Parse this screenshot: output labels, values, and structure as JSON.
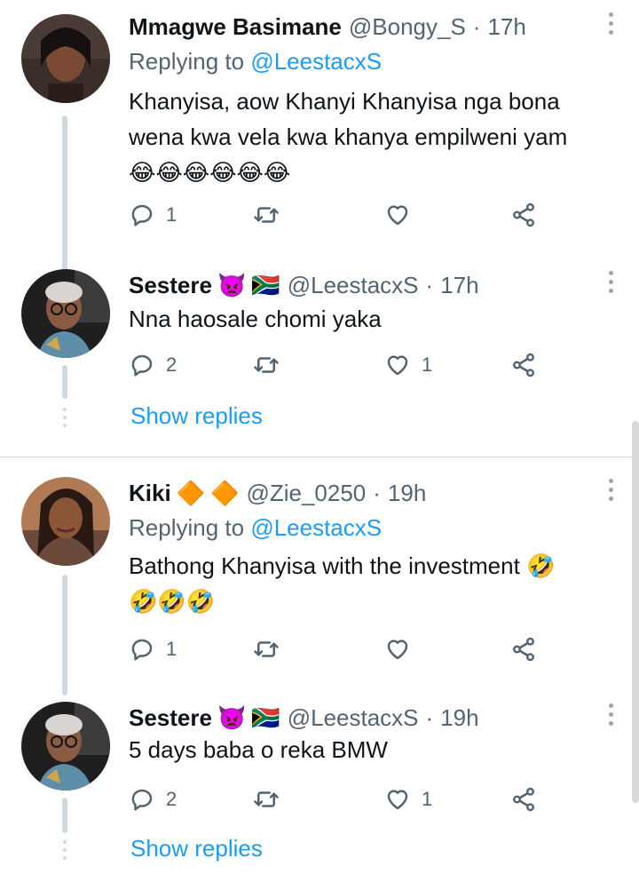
{
  "tweets": [
    {
      "name": "Mmagwe Basimane",
      "handle": "@Bongy_S",
      "separator": "·",
      "time": "17h",
      "replying_prefix": "Replying to ",
      "replying_to": "@LeestacxS",
      "text": "Khanyisa, aow Khanyi Khanyisa nga bona\nwena kwa vela kwa khanya empilweni yam\n😂😂😂😂😂😂",
      "reply_count": "1",
      "retweet_count": "",
      "like_count": ""
    },
    {
      "name": "Sestere",
      "badges": [
        "👿",
        "🇿🇦"
      ],
      "handle": "@LeestacxS",
      "separator": "·",
      "time": "17h",
      "text": "Nna haosale chomi yaka",
      "reply_count": "2",
      "retweet_count": "",
      "like_count": "1"
    },
    {
      "name": "Kiki",
      "badges": [
        "🔶",
        "🔶"
      ],
      "handle": "@Zie_0250",
      "separator": "·",
      "time": "19h",
      "replying_prefix": "Replying to ",
      "replying_to": "@LeestacxS",
      "text": "Bathong Khanyisa with the investment 🤣\n🤣🤣🤣",
      "reply_count": "1",
      "retweet_count": "",
      "like_count": ""
    },
    {
      "name": "Sestere",
      "badges": [
        "👿",
        "🇿🇦"
      ],
      "handle": "@LeestacxS",
      "separator": "·",
      "time": "19h",
      "text": "5 days baba o reka BMW",
      "reply_count": "2",
      "retweet_count": "",
      "like_count": "1"
    }
  ],
  "show_replies_label": "Show replies",
  "icons": [
    "reply-icon",
    "retweet-icon",
    "like-icon",
    "share-icon",
    "more-icon"
  ],
  "colors": {
    "link": "#1d9bf0",
    "secondary": "#536471",
    "thread_line": "#cfd9de"
  }
}
